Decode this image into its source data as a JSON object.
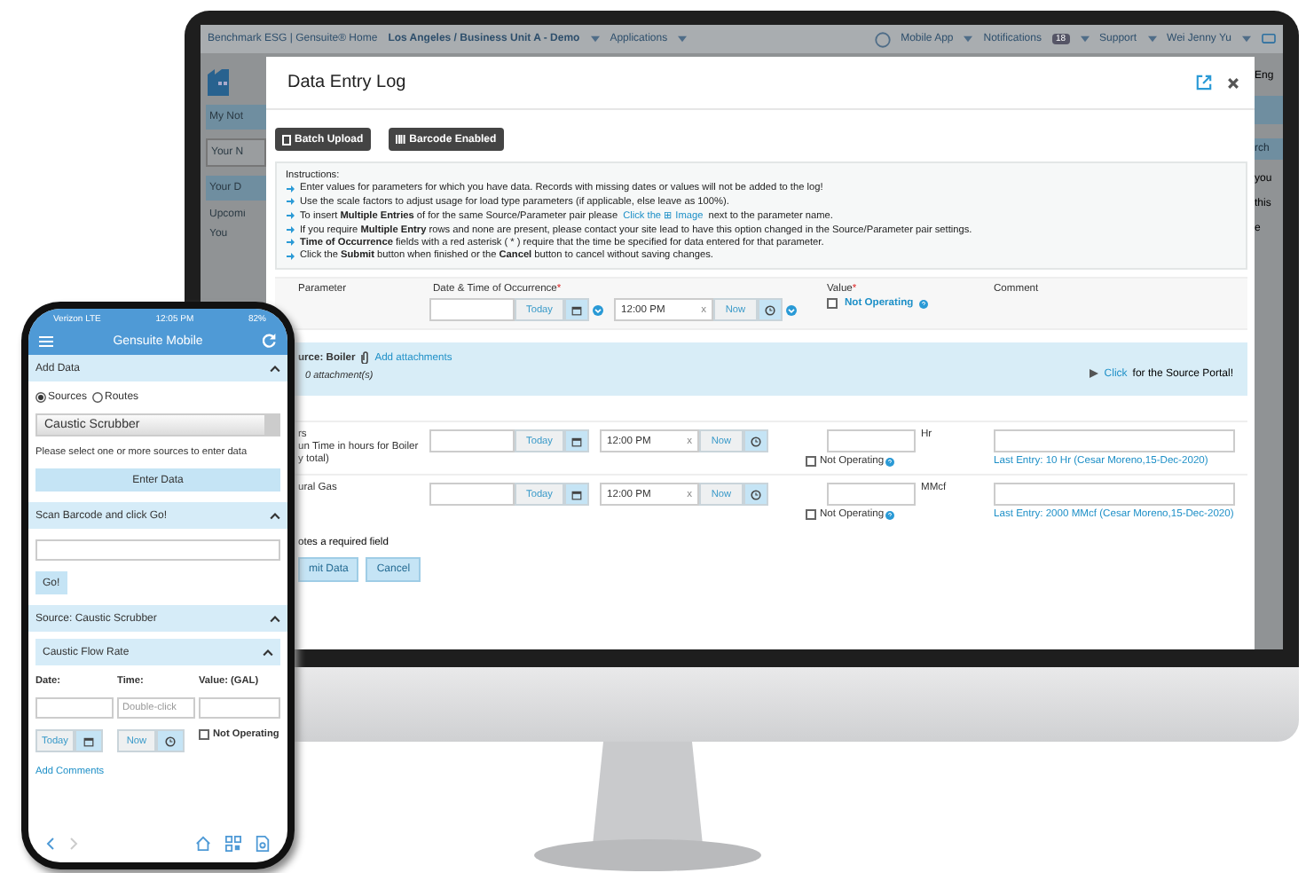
{
  "top_bar": {
    "brand": "Benchmark ESG | Gensuite® Home",
    "location": "Los Angeles / Business Unit A - Demo",
    "applications": "Applications",
    "mobile_app": "Mobile App",
    "notifications": "Notifications",
    "notification_count": "18",
    "support": "Support",
    "user": "Wei Jenny Yu"
  },
  "background_left": [
    {
      "text": "My Not",
      "kind": "bar"
    },
    {
      "text": "Your N",
      "kind": "tab"
    },
    {
      "text": "Your D",
      "kind": "bar"
    },
    {
      "text": "Upcomi",
      "kind": "plain"
    },
    {
      "text": "You",
      "kind": "plain"
    }
  ],
  "background_right": [
    {
      "text": "Eng",
      "kind": "plain"
    },
    {
      "kind": "bar"
    },
    {
      "text": "rch",
      "kind": "button"
    },
    {
      "text": "you",
      "kind": "plain"
    },
    {
      "text": "this",
      "kind": "plain"
    },
    {
      "text": "e",
      "kind": "plain"
    }
  ],
  "modal": {
    "title": "Data Entry Log",
    "buttons": [
      {
        "label": "Batch Upload",
        "kind": "upload"
      },
      {
        "label": "Barcode Enabled",
        "kind": "barcode"
      }
    ],
    "instructions_title": "Instructions:",
    "instructions": [
      {
        "text": "Enter values for parameters for which you have data. Records with missing dates or values will not be added to the log!"
      },
      {
        "text": "Use the scale factors to adjust usage for load type parameters (if applicable, else leave as 100%)."
      },
      {
        "text": "To insert **Multiple Entries** of for the same Source/Parameter pair please",
        "link": "Click the ⊞ Image",
        "after": "next to the parameter name."
      },
      {
        "text": "If you require **Multiple Entry** rows and none are present, please contact your site lead to have this option changed in the Source/Parameter pair settings."
      },
      {
        "text": "**Time of Occurrence** fields with a red asterisk ( * ) require that the time be specified for data entered for that parameter."
      },
      {
        "text": "Click the **Submit** button when finished or the **Cancel** button to cancel without saving changes."
      }
    ],
    "header": {
      "parameter": "Parameter",
      "date_time": "Date & Time of Occurrence",
      "value": "Value",
      "comment": "Comment",
      "required_mark": "*",
      "today": "Today",
      "time": "12:00 PM",
      "clear": "x",
      "now": "Now",
      "not_operating": "Not Operating",
      "not_operating_checked": false
    },
    "source": {
      "name": "urce: Boiler",
      "add_attachments": "Add attachments",
      "attachments": "0 attachment(s)",
      "portal_link": "Click",
      "portal_text": "for the Source Portal!"
    },
    "rows": [
      {
        "param_lines": [
          "rs",
          "un Time in hours for Boiler",
          "y total)"
        ],
        "today": "Today",
        "time": "12:00 PM",
        "clear": "x",
        "now": "Now",
        "unit": "Hr",
        "not_operating": "Not Operating",
        "not_operating_checked": false,
        "last_entry": "Last Entry: 10 Hr (Cesar Moreno,15-Dec-2020)"
      },
      {
        "param_lines": [
          "ural Gas"
        ],
        "today": "Today",
        "time": "12:00 PM",
        "clear": "x",
        "now": "Now",
        "unit": "MMcf",
        "not_operating": "Not Operating",
        "not_operating_checked": false,
        "last_entry": "Last Entry: 2000 MMcf (Cesar Moreno,15-Dec-2020)"
      }
    ],
    "required_note": "otes a required field",
    "submit": "mit Data",
    "cancel": "Cancel"
  },
  "phone": {
    "carrier": "Verizon  LTE",
    "time": "12:05 PM",
    "battery": "82%",
    "title": "Gensuite Mobile",
    "add_data": "Add Data",
    "radios": [
      {
        "label": "Sources",
        "selected": true
      },
      {
        "label": "Routes",
        "selected": false
      }
    ],
    "source_select": "Caustic Scrubber",
    "hint": "Please select one or more sources to enter data",
    "enter_data": "Enter Data",
    "scan": "Scan Barcode and click Go!",
    "go": "Go!",
    "source_bar": "Source: Caustic Scrubber",
    "parameter_bar": "Caustic Flow Rate",
    "date_label": "Date:",
    "time_label": "Time:",
    "value_label": "Value: (GAL)",
    "time_placeholder": "Double-click",
    "today": "Today",
    "now": "Now",
    "not_operating": "Not Operating",
    "not_operating_checked": false,
    "add_comments": "Add Comments"
  }
}
